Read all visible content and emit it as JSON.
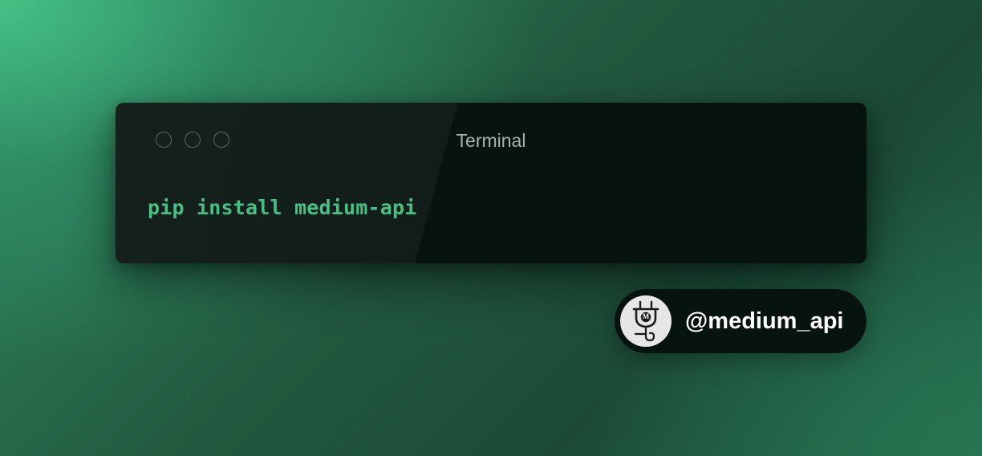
{
  "terminal": {
    "title": "Terminal",
    "command": "pip install medium-api",
    "window_controls": [
      "close",
      "minimize",
      "maximize"
    ]
  },
  "badge": {
    "handle": "@medium_api",
    "avatar_icon": "plug-m-logo-icon",
    "avatar_logo_letter": "M"
  },
  "colors": {
    "command_text": "#48bf84",
    "terminal_bg": "#07130f",
    "title_text": "#a9b1ae",
    "badge_text": "#ffffff"
  }
}
